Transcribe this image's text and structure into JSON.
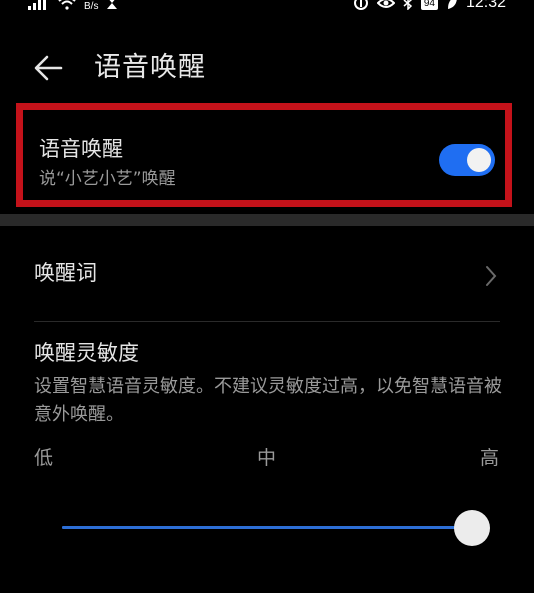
{
  "status_bar": {
    "speed_unit": "B/s",
    "battery": "94",
    "time": "12:32",
    "icons": [
      "signal-icon",
      "wifi-icon",
      "hourglass-icon",
      "nfc-icon",
      "eye-icon",
      "bluetooth-icon",
      "battery-icon",
      "leaf-icon"
    ]
  },
  "header": {
    "title": "语音唤醒",
    "back_icon": "back-arrow-icon"
  },
  "voice_wake": {
    "title": "语音唤醒",
    "subtitle": "说“小艺小艺”唤醒",
    "enabled": true,
    "highlight_color": "#c4121a",
    "toggle_color": "#1f6ef2"
  },
  "wake_word": {
    "label": "唤醒词",
    "icon": "chevron-right-icon"
  },
  "sensitivity": {
    "title": "唤醒灵敏度",
    "description": "设置智慧语音灵敏度。不建议灵敏度过高，以免智慧语音被意外唤醒。",
    "levels": [
      "低",
      "中",
      "高"
    ],
    "value": 1.0,
    "accent_color": "#2d6fd6"
  }
}
